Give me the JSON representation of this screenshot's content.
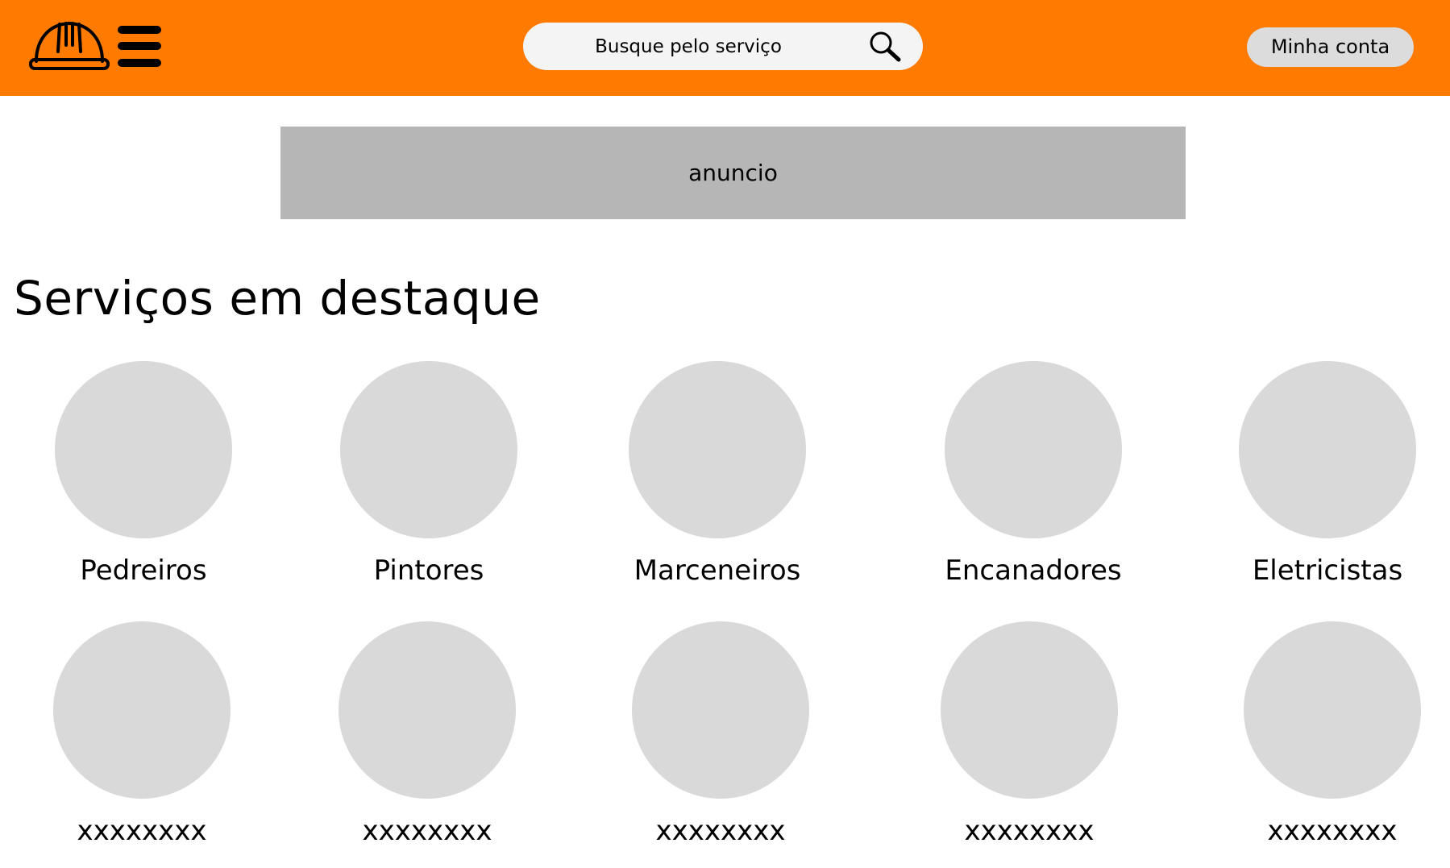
{
  "header": {
    "logo_icon": "hard-hat-icon",
    "menu_icon": "hamburger-menu-icon",
    "search": {
      "placeholder": "Busque pelo serviço",
      "icon": "search-icon"
    },
    "account_label": "Minha conta"
  },
  "banner": {
    "label": "anuncio"
  },
  "featured": {
    "title": "Serviços em destaque",
    "items": [
      {
        "label": "Pedreiros"
      },
      {
        "label": "Pintores"
      },
      {
        "label": "Marceneiros"
      },
      {
        "label": "Encanadores"
      },
      {
        "label": "Eletricistas"
      },
      {
        "label": "xxxxxxxx"
      },
      {
        "label": "xxxxxxxx"
      },
      {
        "label": "xxxxxxxx"
      },
      {
        "label": "xxxxxxxx"
      },
      {
        "label": "xxxxxxxx"
      }
    ]
  },
  "colors": {
    "header_bg": "#ff7b00",
    "banner_bg": "#b6b6b6",
    "placeholder_circle": "#d9d9d9",
    "account_button_bg": "#dcdcdc"
  }
}
